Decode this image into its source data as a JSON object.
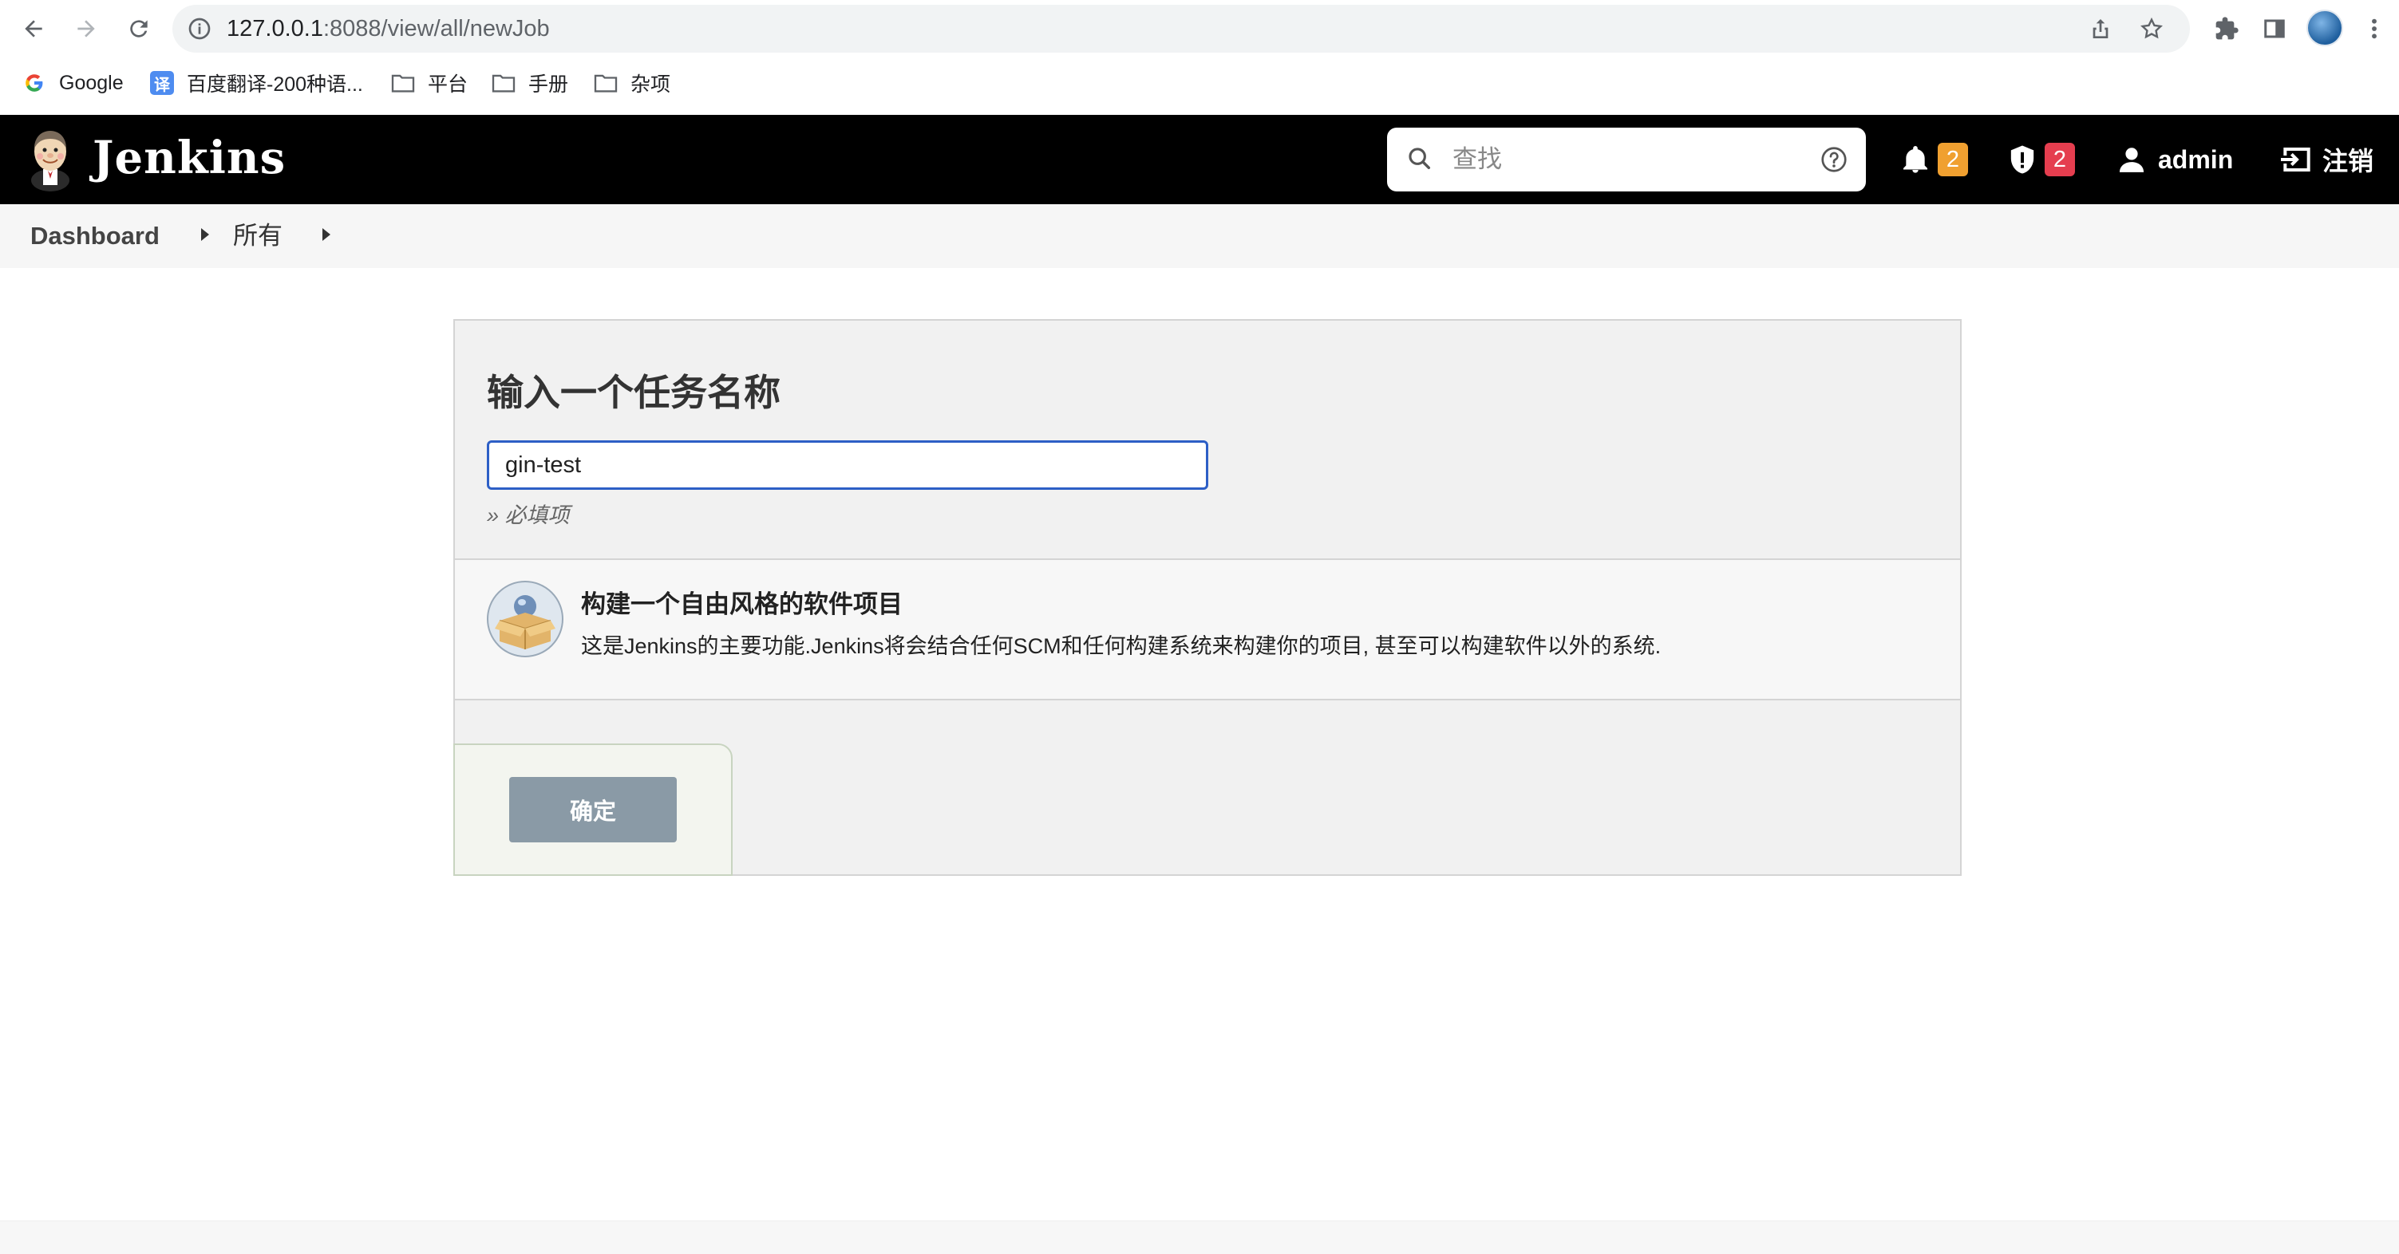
{
  "browser": {
    "url_host": "127.0.0.1",
    "url_path": ":8088/view/all/newJob",
    "bookmarks": [
      {
        "label": "Google",
        "icon": "google-icon"
      },
      {
        "label": "百度翻译-200种语...",
        "icon": "fanyi-icon"
      },
      {
        "label": "平台",
        "icon": "folder-icon"
      },
      {
        "label": "手册",
        "icon": "folder-icon"
      },
      {
        "label": "杂项",
        "icon": "folder-icon"
      }
    ],
    "fanyi_glyph": "译"
  },
  "header": {
    "brand": "Jenkins",
    "search_placeholder": "查找",
    "notifications_count": "2",
    "security_count": "2",
    "user": "admin",
    "logout": "注销"
  },
  "breadcrumb": {
    "items": [
      "Dashboard",
      "所有"
    ]
  },
  "form": {
    "title": "输入一个任务名称",
    "job_name_value": "gin-test",
    "required_hint": "» 必填项",
    "job_type": {
      "title": "构建一个自由风格的软件项目",
      "description": "这是Jenkins的主要功能.Jenkins将会结合任何SCM和任何构建系统来构建你的项目, 甚至可以构建软件以外的系统."
    },
    "ok_label": "确定"
  },
  "colors": {
    "header_bg": "#000000",
    "badge_orange": "#f0a030",
    "badge_red": "#e53e4f",
    "input_focus": "#2d5fc6",
    "ok_button": "#8a9aa6"
  }
}
